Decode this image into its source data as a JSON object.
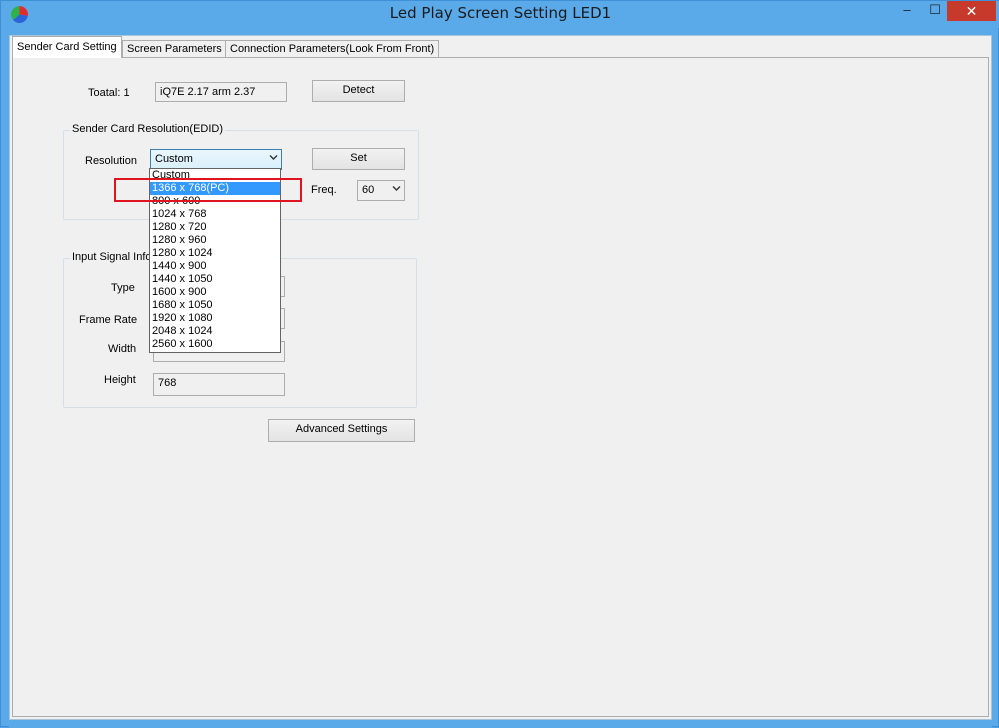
{
  "window": {
    "title": "Led Play Screen Setting LED1",
    "minimize": "–",
    "maximize": "☐",
    "close": "✕"
  },
  "tabs": [
    {
      "label": "Sender Card Setting"
    },
    {
      "label": "Screen Parameters"
    },
    {
      "label": "Connection Parameters(Look From Front)"
    }
  ],
  "sender": {
    "total_label": "Toatal: 1",
    "version": "iQ7E 2.17 arm 2.37",
    "detect_label": "Detect"
  },
  "resolution_group": {
    "title": "Sender Card Resolution(EDID)",
    "resolution_label": "Resolution",
    "selected": "Custom",
    "set_label": "Set",
    "freq_label": "Freq.",
    "freq_value": "60",
    "options": [
      "Custom",
      "1366 x 768(PC)",
      " 800 x 600",
      "1024 x 768",
      "1280 x 720",
      "1280 x 960",
      "1280 x 1024",
      "1440 x 900",
      "1440 x 1050",
      "1600 x 900",
      "1680 x 1050",
      "1920 x 1080",
      "2048 x 1024",
      "2560 x 1600"
    ],
    "highlighted_index": 1
  },
  "input_group": {
    "title": "Input Signal Info",
    "type_label": "Type",
    "frame_rate_label": "Frame Rate",
    "width_label": "Width",
    "height_label": "Height",
    "height_value": "768"
  },
  "advanced_label": "Advanced Settings",
  "colors": {
    "titlebar": "#5aaaea",
    "close_button": "#c7392b",
    "selection": "#3399ff",
    "annotation": "#e0141e"
  }
}
